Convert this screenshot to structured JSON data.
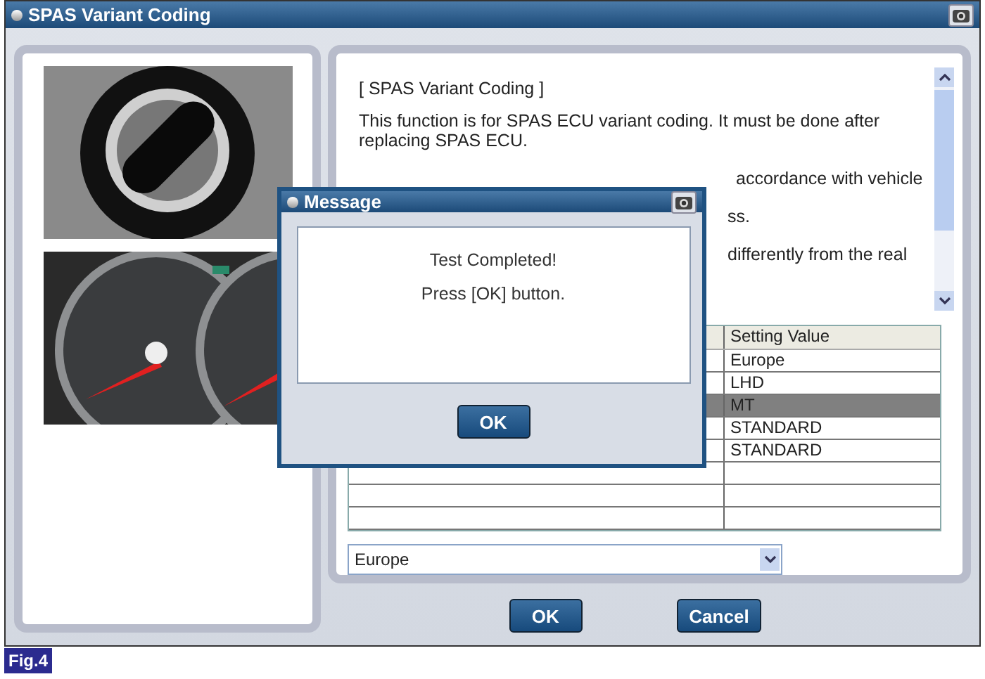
{
  "window": {
    "title": "SPAS Variant Coding"
  },
  "help_text": {
    "heading": "[ SPAS Variant Coding ]",
    "paragraph": "This function is for SPAS ECU variant coding. It must be done after replacing SPAS ECU.",
    "visible_fragments": [
      "accordance with vehicle",
      "ss.",
      "differently from the real"
    ]
  },
  "table": {
    "column_2": "Setting Value",
    "rows": [
      {
        "value": "Europe",
        "selected": false
      },
      {
        "value": "LHD",
        "selected": false
      },
      {
        "value": "MT",
        "selected": true
      },
      {
        "value": "STANDARD",
        "selected": false
      },
      {
        "value": "STANDARD",
        "selected": false
      }
    ]
  },
  "dropdown": {
    "value": "Europe"
  },
  "buttons": [
    "OK",
    "Cancel"
  ],
  "message_dialog": {
    "title": "Message",
    "lines": [
      "Test Completed!",
      "Press [OK] button."
    ],
    "button": "OK"
  },
  "figure_label": "Fig.4"
}
